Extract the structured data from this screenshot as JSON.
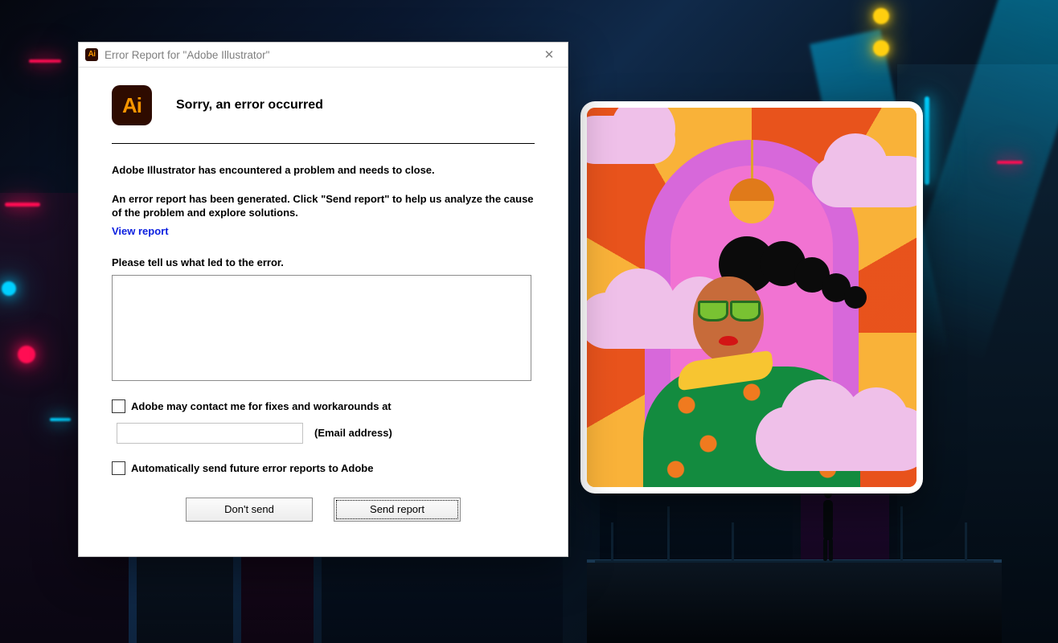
{
  "dialog": {
    "title": "Error Report for \"Adobe Illustrator\"",
    "heading": "Sorry, an error occurred",
    "line1": "Adobe Illustrator has encountered a problem and needs to close.",
    "line2": "An error report has been generated. Click \"Send report\" to help us analyze the cause of the problem and explore solutions.",
    "view_report": "View report",
    "describe_label": "Please tell us what led to the error.",
    "describe_value": "",
    "contact_checkbox_label": "Adobe may contact me for fixes and workarounds at",
    "email_value": "",
    "email_hint": "(Email address)",
    "auto_send_label": "Automatically send future error reports to Adobe",
    "btn_dont_send": "Don't send",
    "btn_send": "Send report",
    "icon_text_small": "Ai",
    "icon_text_large": "Ai",
    "close_glyph": "✕"
  }
}
